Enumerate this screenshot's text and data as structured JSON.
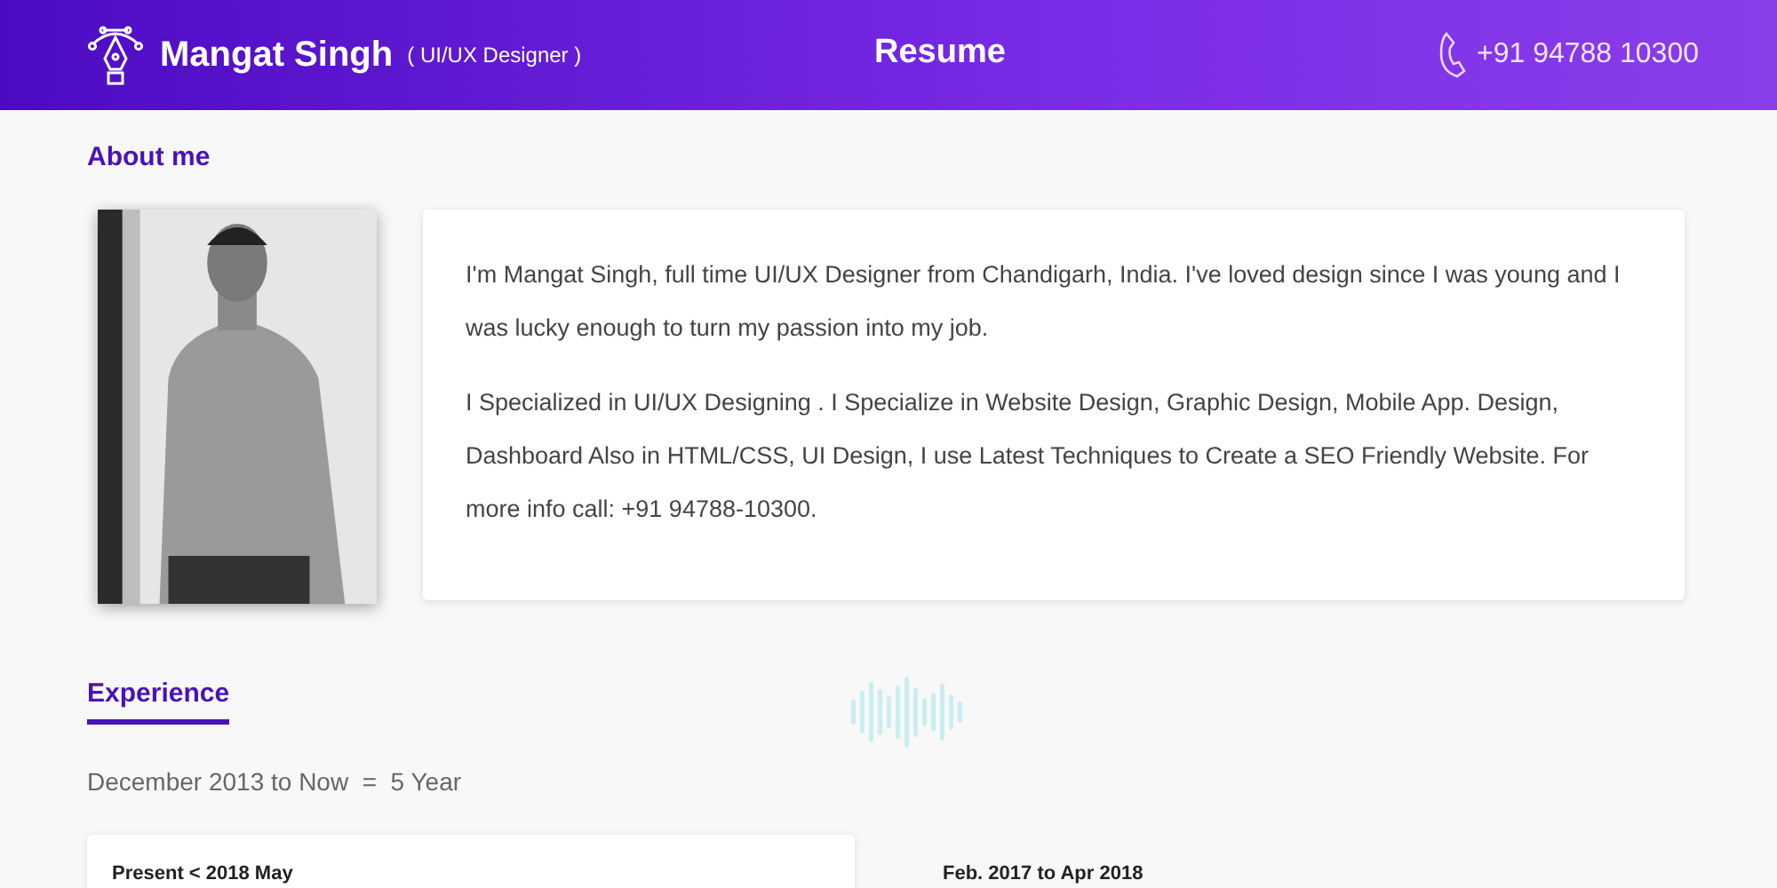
{
  "header": {
    "name": "Mangat Singh",
    "role": "( UI/UX Designer )",
    "title": "Resume",
    "phone": "+91 94788 10300"
  },
  "about": {
    "heading": "About me",
    "paragraphs": [
      "I'm Mangat Singh, full time UI/UX Designer from Chandigarh, India. I've loved design since I was young and I was lucky enough to turn my passion into my job.",
      "I Specialized in UI/UX Designing . I Specialize in Website Design, Graphic Design, Mobile App. Design, Dashboard Also in HTML/CSS, UI Design, I use Latest Techniques to Create a SEO Friendly Website. For more info call: +91 94788-10300."
    ]
  },
  "experience": {
    "heading": "Experience",
    "summary": "December 2013 to Now  =  5 Year",
    "jobs": [
      {
        "period": "Present  <  2018 May",
        "kind": "card"
      },
      {
        "period": "Feb. 2017 to Apr 2018",
        "kind": "plain"
      }
    ]
  }
}
